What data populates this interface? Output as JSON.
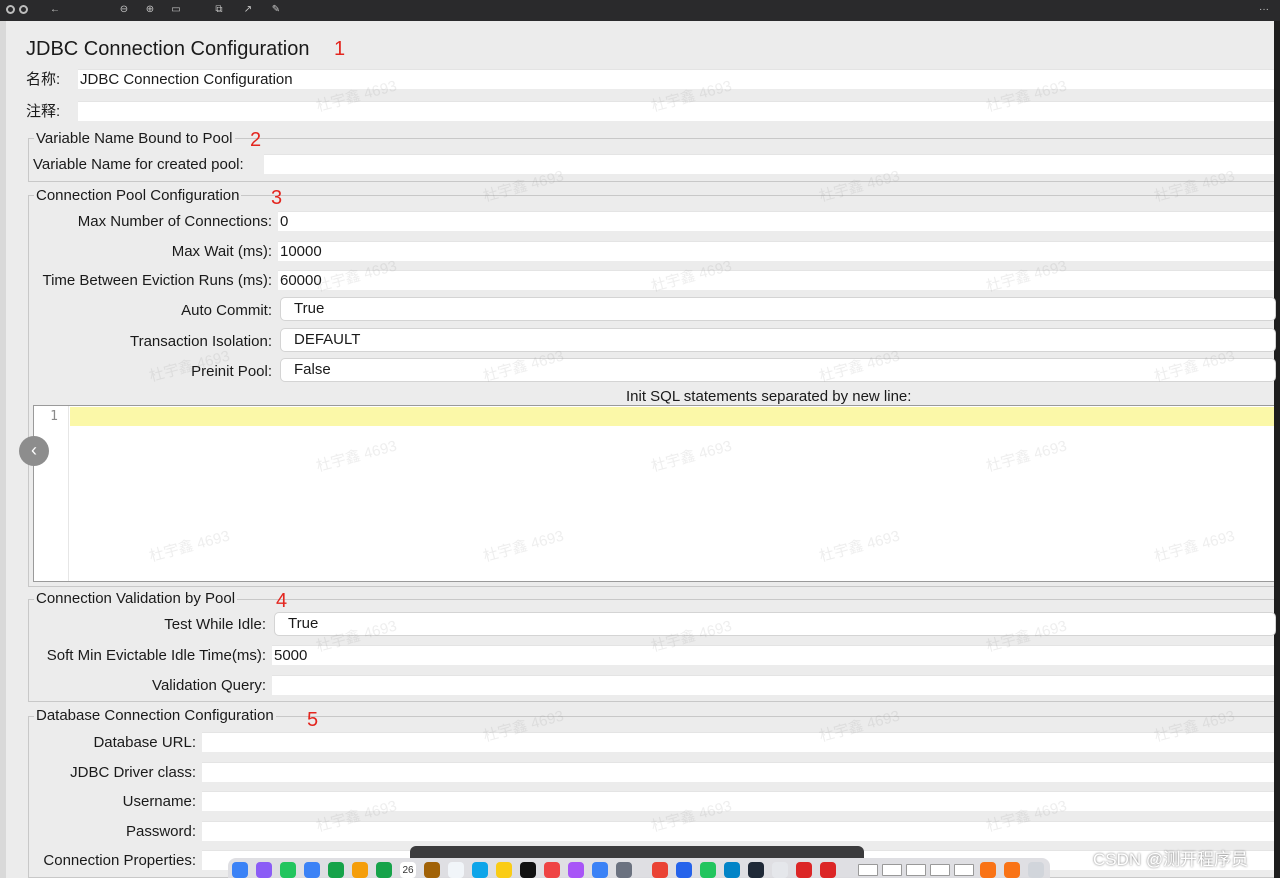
{
  "window": {
    "title": "JDBC Connection Configuration"
  },
  "toolbar": {
    "icons": [
      "back-icon",
      "zoom-out-icon",
      "zoom-in-icon",
      "fit-window-icon",
      "copy-icon",
      "share-icon",
      "markup-icon",
      "more-icon"
    ],
    "more_label": "···"
  },
  "annotations": [
    "1",
    "2",
    "3",
    "4",
    "5"
  ],
  "general": {
    "name_label": "名称:",
    "name_value": "JDBC Connection Configuration",
    "comment_label": "注释:",
    "comment_value": ""
  },
  "variable_section": {
    "title": "Variable Name Bound to Pool",
    "pool_label": "Variable Name for created pool:",
    "pool_value": ""
  },
  "pool_section": {
    "title": "Connection Pool Configuration",
    "max_connections_label": "Max Number of Connections:",
    "max_connections_value": "0",
    "max_wait_label": "Max Wait (ms):",
    "max_wait_value": "10000",
    "eviction_label": "Time Between Eviction Runs (ms):",
    "eviction_value": "60000",
    "auto_commit_label": "Auto Commit:",
    "auto_commit_value": "True",
    "isolation_label": "Transaction Isolation:",
    "isolation_value": "DEFAULT",
    "preinit_label": "Preinit Pool:",
    "preinit_value": "False",
    "init_sql_label": "Init SQL statements separated by new line:",
    "init_sql_line_number": "1"
  },
  "validation_section": {
    "title": "Connection Validation by Pool",
    "test_idle_label": "Test While Idle:",
    "test_idle_value": "True",
    "soft_min_label": "Soft Min Evictable Idle Time(ms):",
    "soft_min_value": "5000",
    "validation_query_label": "Validation Query:",
    "validation_query_value": ""
  },
  "database_section": {
    "title": "Database Connection Configuration",
    "url_label": "Database URL:",
    "url_value": "",
    "driver_label": "JDBC Driver class:",
    "driver_value": "",
    "username_label": "Username:",
    "username_value": "",
    "password_label": "Password:",
    "password_value": "",
    "properties_label": "Connection Properties:",
    "properties_value": ""
  },
  "watermark_text": "杜宇鑫 4693",
  "dock": {
    "calendar_day": "26"
  },
  "footer": {
    "csdn_watermark": "CSDN @测开程序员"
  },
  "colors": {
    "annotation": "#e3261f",
    "current_line": "#fbf8a8",
    "panel_bg": "#ececec"
  }
}
